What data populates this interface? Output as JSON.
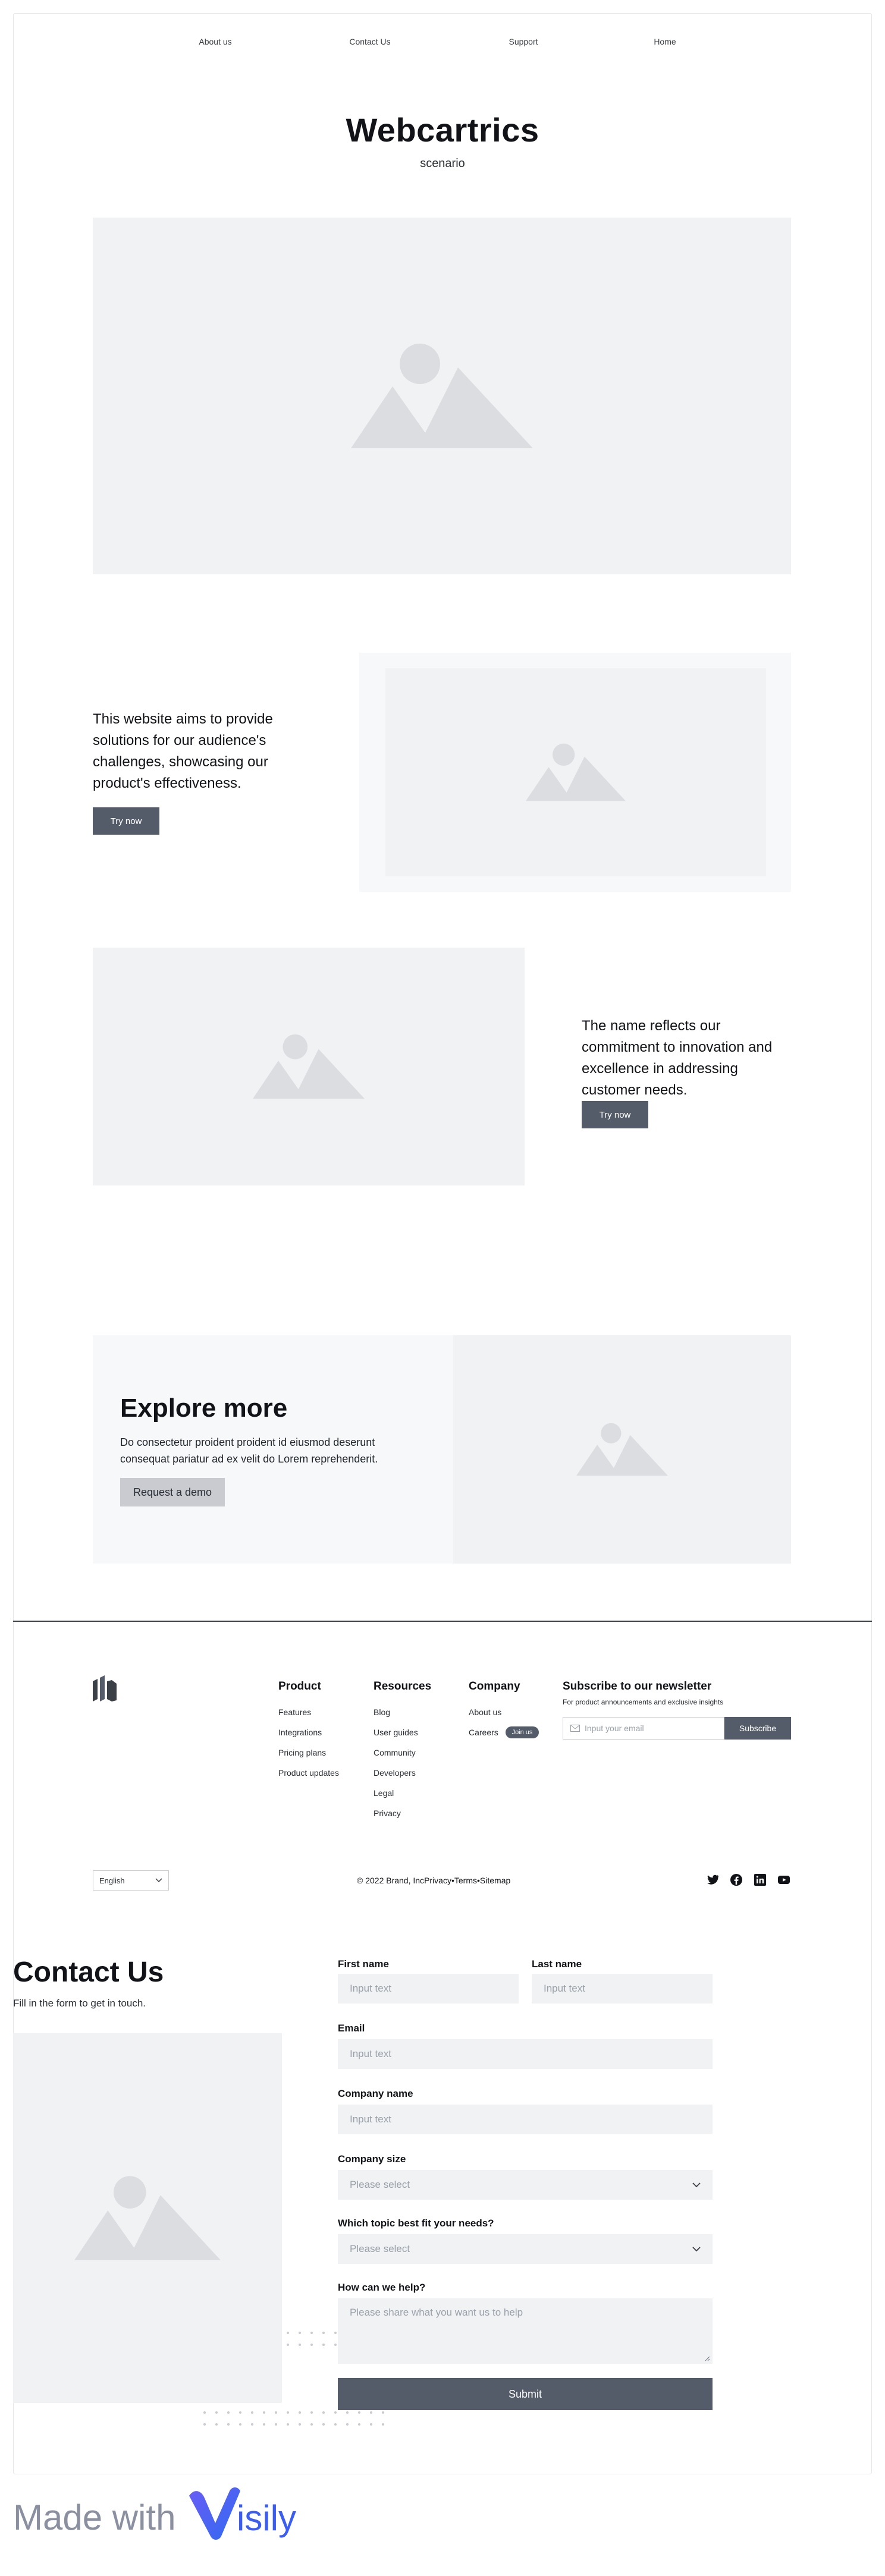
{
  "nav": {
    "links": [
      "About us",
      "Contact Us",
      "Support",
      "Home"
    ]
  },
  "hero": {
    "title": "Webcartrics",
    "subtitle": "scenario"
  },
  "features": [
    {
      "text": "This website aims to provide solutions for our audience's challenges, showcasing our product's effectiveness.",
      "button": "Try now"
    },
    {
      "text": "The name reflects our commitment to innovation and excellence in addressing customer needs.",
      "button": "Try now"
    }
  ],
  "explore": {
    "title": "Explore more",
    "body": "Do consectetur proident proident id eiusmod deserunt consequat pariatur ad ex velit do Lorem reprehenderit.",
    "button": "Request a demo"
  },
  "footer": {
    "columns": [
      {
        "heading": "Product",
        "links": [
          "Features",
          "Integrations",
          "Pricing plans",
          "Product updates"
        ]
      },
      {
        "heading": "Resources",
        "links": [
          "Blog",
          "User guides",
          "Community",
          "Developers",
          "Legal",
          "Privacy"
        ]
      },
      {
        "heading": "Company",
        "links": [
          "About us",
          "Careers"
        ],
        "badge": "Join us"
      }
    ],
    "newsletter": {
      "heading": "Subscribe to our newsletter",
      "subtext": "For product announcements and exclusive insights",
      "placeholder": "Input your email",
      "button": "Subscribe"
    },
    "language": "English",
    "copyright": "© 2022 Brand, Inc",
    "legal_links": [
      "Privacy",
      "Terms",
      "Sitemap"
    ],
    "separator": "•",
    "social_icons": [
      "twitter-icon",
      "facebook-icon",
      "linkedin-icon",
      "youtube-icon"
    ]
  },
  "contact": {
    "title": "Contact Us",
    "subtitle": "Fill in the form to get in touch.",
    "fields": {
      "first_name": {
        "label": "First name",
        "placeholder": "Input text"
      },
      "last_name": {
        "label": "Last name",
        "placeholder": "Input text"
      },
      "email": {
        "label": "Email",
        "placeholder": "Input text"
      },
      "company_name": {
        "label": "Company name",
        "placeholder": "Input text"
      },
      "company_size": {
        "label": "Company size",
        "placeholder": "Please select"
      },
      "topic": {
        "label": "Which topic best fit your needs?",
        "placeholder": "Please select"
      },
      "help": {
        "label": "How can we help?",
        "placeholder": "Please share what you want us to help"
      }
    },
    "submit": "Submit"
  },
  "branding": {
    "made_with": "Made with",
    "brand": "Visily"
  },
  "colors": {
    "primary_button": "#555c69",
    "placeholder_bg": "#f1f2f4",
    "brand_gradient_start": "#6a5cf5",
    "brand_gradient_end": "#2f6bf0"
  }
}
